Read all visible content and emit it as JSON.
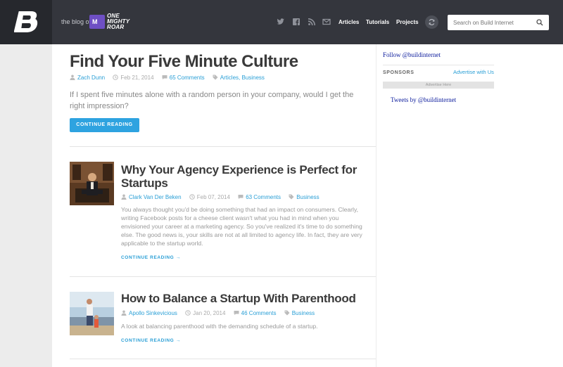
{
  "header": {
    "blog_of": "the blog of",
    "brand_badge": "M",
    "brand_lines": [
      "ONE",
      "MIGHTY",
      "ROAR"
    ],
    "social_icons": [
      "twitter-icon",
      "facebook-icon",
      "rss-icon",
      "mail-icon"
    ],
    "nav": [
      "Articles",
      "Tutorials",
      "Projects"
    ],
    "search_placeholder": "Search on Build Internet"
  },
  "featured": {
    "title": "Find Your Five Minute Culture",
    "author": "Zach Dunn",
    "date": "Feb 21, 2014",
    "comments": "65 Comments",
    "categories": "Articles, Business",
    "excerpt": "If I spent five minutes alone with a random person in your company, would I get the right impression?",
    "button": "CONTINUE READING"
  },
  "posts": [
    {
      "title": "Why Your Agency Experience is Perfect for Startups",
      "author": "Clark Van Der Beken",
      "date": "Feb 07, 2014",
      "comments": "63 Comments",
      "categories": "Business",
      "excerpt": "You always thought you'd be doing something that had an impact on consumers. Clearly, writing Facebook posts for a cheese client wasn't what you had in mind when you envisioned your career at a marketing agency. So you've realized it's time to do something else. The good news is, your skills are not at all limited to agency life. In fact, they are very applicable to the startup world.",
      "link": "CONTINUE READING →"
    },
    {
      "title": "How to Balance a Startup With Parenthood",
      "author": "Apollo Sinkevicious",
      "date": "Jan 20, 2014",
      "comments": "46 Comments",
      "categories": "Business",
      "excerpt": "A look at balancing parenthood with the demanding schedule of a startup.",
      "link": "CONTINUE READING →"
    }
  ],
  "sidebar": {
    "follow": "Follow @buildinternet",
    "sponsors": "SPONSORS",
    "advertise_us": "Advertise with Us",
    "advertise_here": "Advertise Here",
    "tweets": "Tweets by @buildinternet"
  },
  "colors": {
    "header": "#34363d",
    "accent": "#2ea3e0",
    "brand": "#6e4fc4"
  }
}
